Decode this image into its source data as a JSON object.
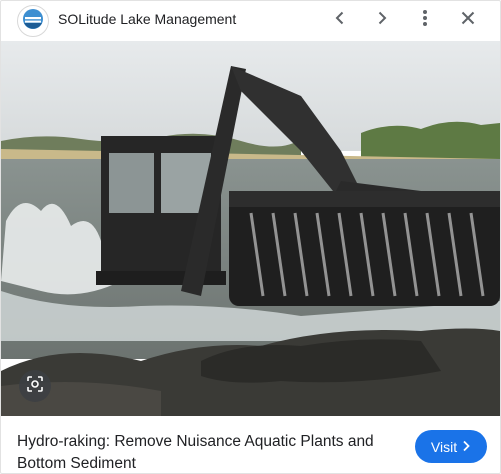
{
  "header": {
    "site_name": "SOLitude Lake Management",
    "icons": {
      "logo": "solitude-logo-icon",
      "prev": "chevron-left-icon",
      "next": "chevron-right-icon",
      "more": "more-vert-icon",
      "close": "close-icon"
    }
  },
  "image": {
    "lens_icon": "lens-search-icon"
  },
  "footer": {
    "title": "Hydro-raking: Remove Nuisance Aquatic Plants and Bottom Sediment",
    "visit_label": "Visit",
    "visit_icon": "chevron-right-icon"
  },
  "colors": {
    "accent": "#1a73e8",
    "text": "#202124",
    "icon": "#5f6368"
  }
}
